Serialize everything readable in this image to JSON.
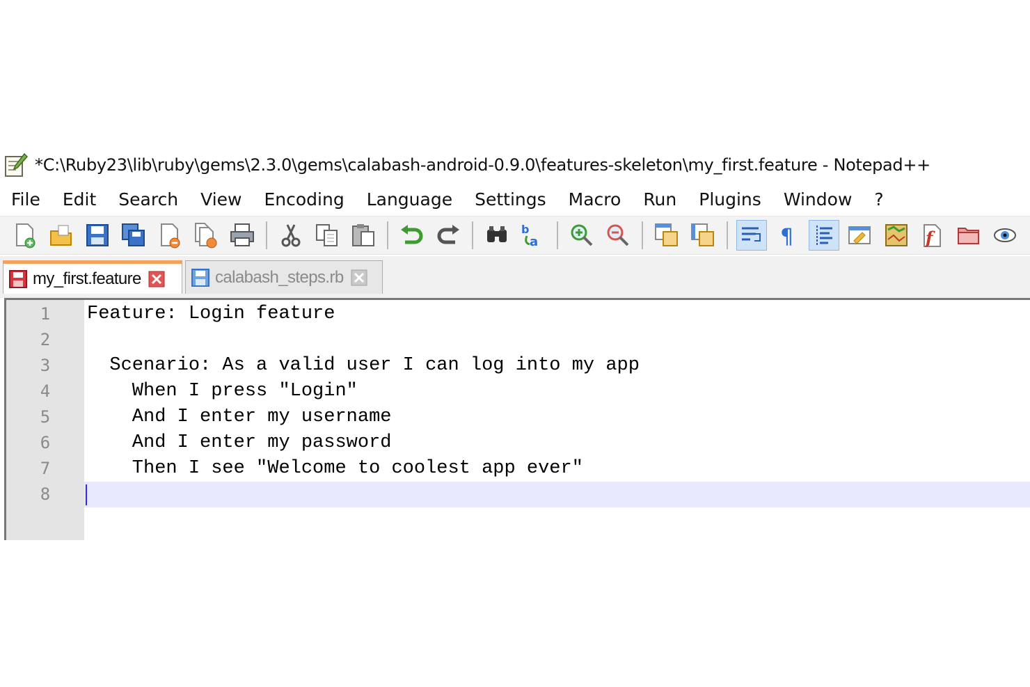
{
  "window": {
    "title": "*C:\\Ruby23\\lib\\ruby\\gems\\2.3.0\\gems\\calabash-android-0.9.0\\features-skeleton\\my_first.feature - Notepad++"
  },
  "menu": [
    "File",
    "Edit",
    "Search",
    "View",
    "Encoding",
    "Language",
    "Settings",
    "Macro",
    "Run",
    "Plugins",
    "Window",
    "?"
  ],
  "toolbar": {
    "buttons": [
      "new-file-icon",
      "open-file-icon",
      "save-icon",
      "save-all-icon",
      "close-icon",
      "close-all-icon",
      "print-icon",
      "cut-icon",
      "copy-icon",
      "paste-icon",
      "undo-icon",
      "redo-icon",
      "find-icon",
      "replace-icon",
      "zoom-in-icon",
      "zoom-out-icon",
      "sync-vertical-icon",
      "sync-horizontal-icon",
      "word-wrap-icon",
      "show-all-characters-icon",
      "indent-guide-icon",
      "user-defined-language-icon",
      "document-map-icon",
      "function-list-icon",
      "folder-as-workspace-icon",
      "monitoring-icon"
    ],
    "active": [
      "word-wrap-icon",
      "indent-guide-icon"
    ]
  },
  "tabs": [
    {
      "label": "my_first.feature",
      "active": true,
      "modified": true
    },
    {
      "label": "calabash_steps.rb",
      "active": false,
      "modified": false
    }
  ],
  "editor": {
    "current_line": 8,
    "lines": [
      {
        "num": "1",
        "text": "Feature: Login feature"
      },
      {
        "num": "2",
        "text": ""
      },
      {
        "num": "3",
        "text": "  Scenario: As a valid user I can log into my app"
      },
      {
        "num": "4",
        "text": "    When I press \"Login\""
      },
      {
        "num": "5",
        "text": "    And I enter my username"
      },
      {
        "num": "6",
        "text": "    And I enter my password"
      },
      {
        "num": "7",
        "text": "    Then I see \"Welcome to coolest app ever\""
      },
      {
        "num": "8",
        "text": ""
      }
    ]
  },
  "colors": {
    "active_tab_accent": "#f4a25b",
    "current_line_bg": "#e8e8ff",
    "gutter_bg": "#e4e4e4",
    "line_number": "#8a8a8a"
  }
}
